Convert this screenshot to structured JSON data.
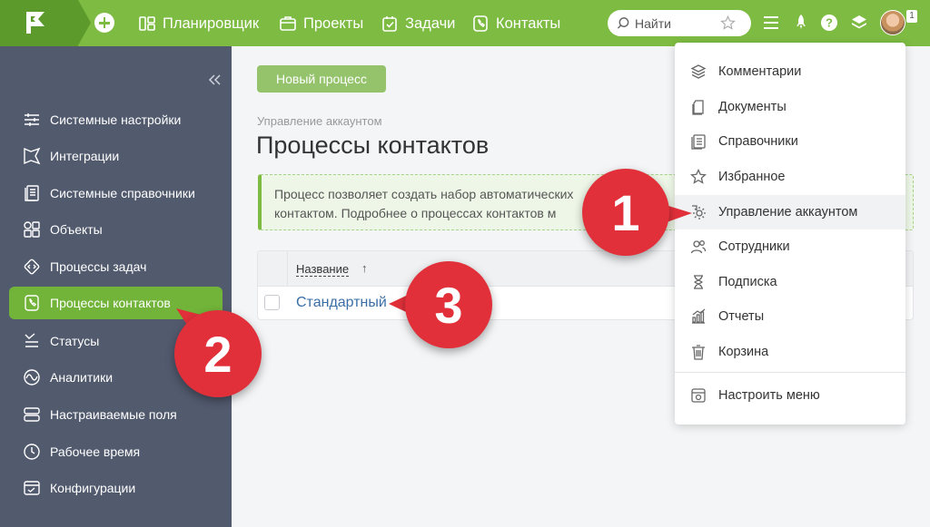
{
  "topbar": {
    "nav": [
      {
        "label": "Планировщик",
        "icon": "planner-icon"
      },
      {
        "label": "Проекты",
        "icon": "projects-icon"
      },
      {
        "label": "Задачи",
        "icon": "tasks-icon"
      },
      {
        "label": "Контакты",
        "icon": "contacts-icon"
      }
    ],
    "search_placeholder": "Найти",
    "notification_count": "1"
  },
  "sidebar": {
    "items": [
      {
        "label": "Системные настройки"
      },
      {
        "label": "Интеграции"
      },
      {
        "label": "Системные справочники"
      },
      {
        "label": "Объекты"
      },
      {
        "label": "Процессы задач"
      },
      {
        "label": "Процессы контактов"
      },
      {
        "label": "Статусы"
      },
      {
        "label": "Аналитики"
      },
      {
        "label": "Настраиваемые поля"
      },
      {
        "label": "Рабочее время"
      },
      {
        "label": "Конфигурации"
      }
    ],
    "active_index": 5
  },
  "main": {
    "new_button": "Новый процесс",
    "breadcrumb": "Управление аккаунтом",
    "title": "Процессы контактов",
    "info_line1": "Процесс позволяет создать набор автоматических",
    "info_line2": "контактом. Подробнее о процессах контактов м",
    "table": {
      "column_name": "Название",
      "sort_arrow": "↑",
      "rows": [
        {
          "name": "Стандартный"
        }
      ]
    }
  },
  "menu": {
    "items": [
      {
        "label": "Комментарии"
      },
      {
        "label": "Документы"
      },
      {
        "label": "Справочники"
      },
      {
        "label": "Избранное"
      },
      {
        "label": "Управление аккаунтом"
      },
      {
        "label": "Сотрудники"
      },
      {
        "label": "Подписка"
      },
      {
        "label": "Отчеты"
      },
      {
        "label": "Корзина"
      }
    ],
    "settings_label": "Настроить меню"
  },
  "badges": [
    "1",
    "2",
    "3"
  ],
  "colors": {
    "brand": "#7dbb42",
    "sidebar": "#525a6e",
    "badge": "#e1303a",
    "link": "#3a6ea5"
  }
}
